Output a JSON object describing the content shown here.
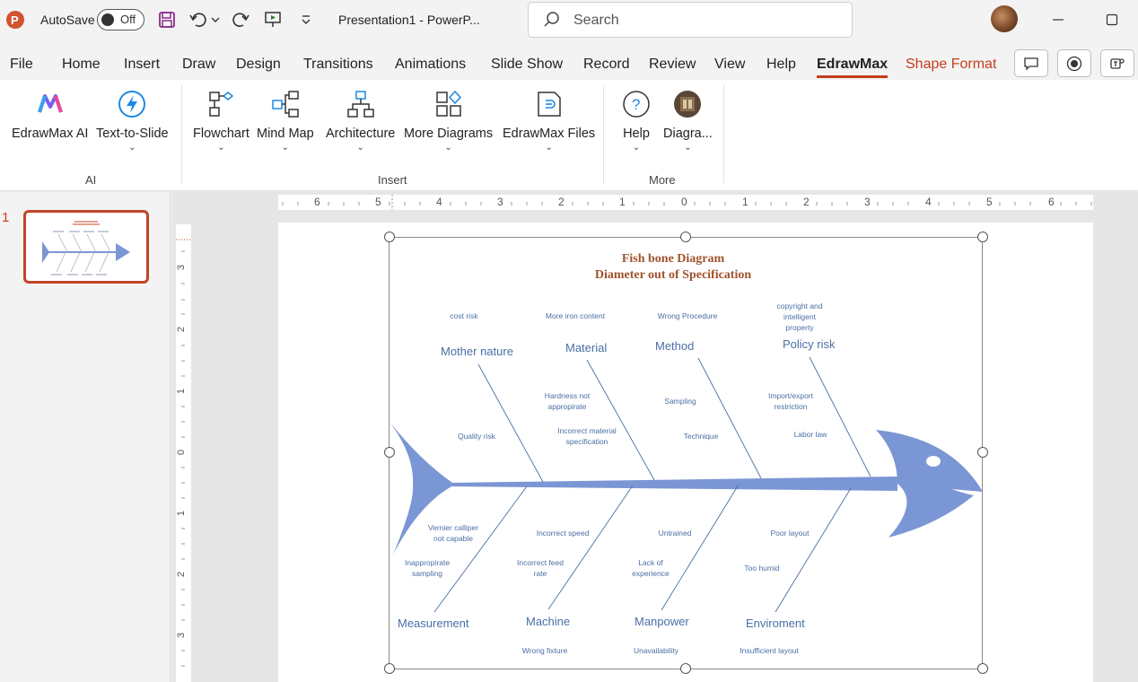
{
  "titlebar": {
    "autosave_label": "AutoSave",
    "autosave_state": "Off",
    "doc_title": "Presentation1  -  PowerP...",
    "search_placeholder": "Search"
  },
  "menu": {
    "tabs": [
      "File",
      "Home",
      "Insert",
      "Draw",
      "Design",
      "Transitions",
      "Animations",
      "Slide Show",
      "Record",
      "Review",
      "View",
      "Help",
      "EdrawMax",
      "Shape Format"
    ],
    "active_tab": "EdrawMax"
  },
  "ribbon": {
    "groups": [
      {
        "label": "AI",
        "buttons": [
          "EdrawMax AI",
          "Text-to-Slide"
        ]
      },
      {
        "label": "Insert",
        "buttons": [
          "Flowchart",
          "Mind Map",
          "Architecture",
          "More Diagrams",
          "EdrawMax Files"
        ]
      },
      {
        "label": "More",
        "buttons": [
          "Help",
          "Diagra..."
        ]
      }
    ]
  },
  "slides_pane": {
    "slide_number": "1"
  },
  "ruler": {
    "h_labels": [
      "6",
      "5",
      "4",
      "3",
      "2",
      "1",
      "0",
      "1",
      "2",
      "3",
      "4",
      "5",
      "6"
    ],
    "v_labels": [
      "3",
      "2",
      "1",
      "0",
      "1",
      "2",
      "3"
    ]
  },
  "diagram": {
    "title_line1": "Fish bone Diagram",
    "title_line2": "Diameter out of Specification",
    "categories": {
      "mother_nature": "Mother nature",
      "material": "Material",
      "method": "Method",
      "policy_risk": "Policy risk",
      "measurement": "Measurement",
      "machine": "Machine",
      "manpower": "Manpower",
      "enviroment": "Enviroment"
    },
    "causes": {
      "cost_risk": "cost risk",
      "more_iron": "More iron content",
      "wrong_procedure": "Wrong Procedure",
      "copyright": "copyright and intelligent property",
      "hardness": "Hardness not appropirate",
      "sampling": "Sampling",
      "import_export": "Import/export restriction",
      "quality_risk": "Quality risk",
      "incorrect_material": "Incorrect material specification",
      "technique": "Technique",
      "labor_law": "Labor law",
      "vernier": "Vernier calliper not capable",
      "incorrect_speed": "Incorrect speed",
      "untrained": "Untrained",
      "poor_layout": "Poor layout",
      "inappropriate_sampling": "Inappropirate sampling",
      "incorrect_feed": "Incorrect feed rate",
      "lack_experience": "Lack of experience",
      "too_humid": "Too humid",
      "wrong_fixture": "Wrong fixture",
      "unavailability": "Unavailability",
      "insufficient_layout": "Insufficient layout"
    },
    "colors": {
      "fish": "#7b96d4",
      "line": "#4a6fa5",
      "title": "#a0522d"
    }
  }
}
